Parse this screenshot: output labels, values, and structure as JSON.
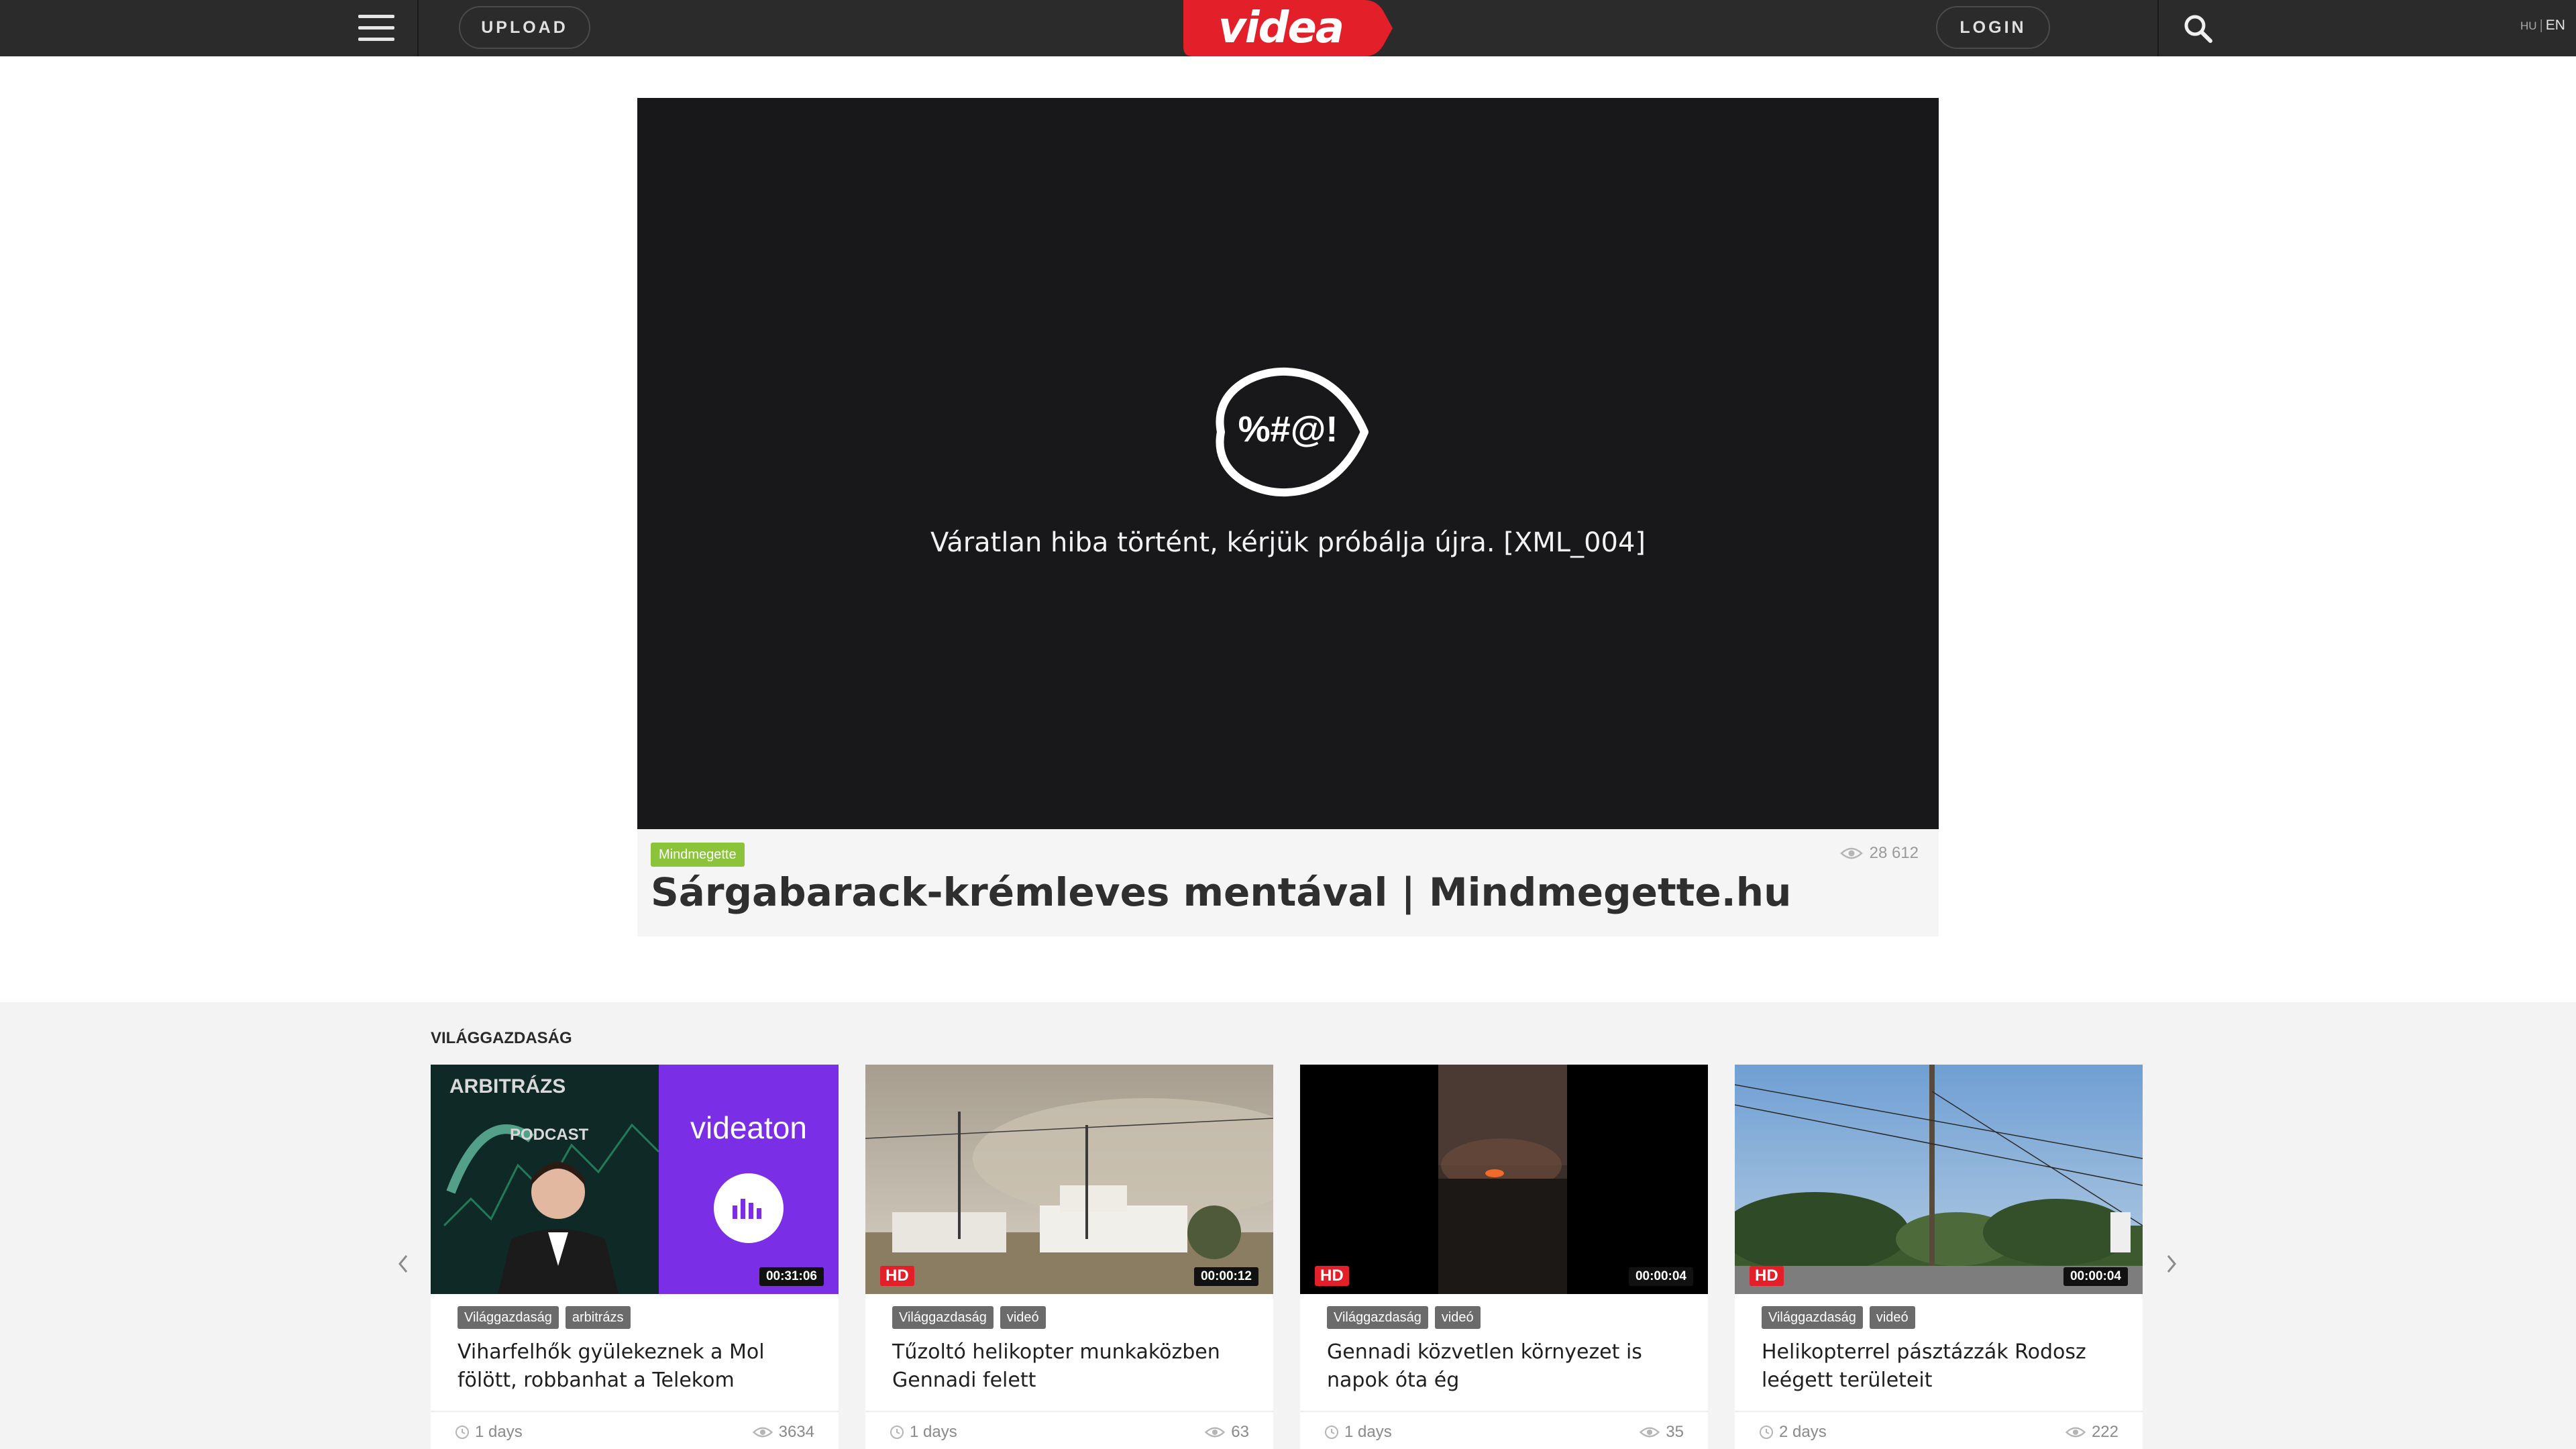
{
  "header": {
    "upload_label": "UPLOAD",
    "logo_text": "videa",
    "login_label": "LOGIN",
    "lang_hu": "HU",
    "lang_sep": "|",
    "lang_en": "EN",
    "logo_color": "#e3202a"
  },
  "player": {
    "error_glyph": "%#@!",
    "error_message": "Váratlan hiba történt, kérjük próbálja újra. [XML_004]"
  },
  "video": {
    "category": "Mindmegette",
    "views": "28 612",
    "title": "Sárgabarack-krémleves mentával | Mindmegette.hu"
  },
  "related": {
    "section_title": "VILÁGGAZDASÁG",
    "cards": [
      {
        "thumb_title_1": "ARBITRÁZS",
        "thumb_title_2": "PODCAST",
        "thumb_brand": "videaton",
        "duration": "00:31:06",
        "tags": [
          "Világgazdaság",
          "arbitrázs"
        ],
        "title": "Viharfelhők gyülekeznek a Mol fölött, robbanhat a Telekom",
        "age": "1 days",
        "views": "3634"
      },
      {
        "hd": "HD",
        "duration": "00:00:12",
        "tags": [
          "Világgazdaság",
          "videó"
        ],
        "title": "Tűzoltó helikopter munkaközben Gennadi felett",
        "age": "1 days",
        "views": "63"
      },
      {
        "hd": "HD",
        "duration": "00:00:04",
        "tags": [
          "Világgazdaság",
          "videó"
        ],
        "title": "Gennadi közvetlen környezet is napok óta ég",
        "age": "1 days",
        "views": "35"
      },
      {
        "hd": "HD",
        "duration": "00:00:04",
        "tags": [
          "Világgazdaság",
          "videó"
        ],
        "title": "Helikopterrel pásztázzák Rodosz leégett területeit",
        "age": "2 days",
        "views": "222"
      }
    ]
  }
}
